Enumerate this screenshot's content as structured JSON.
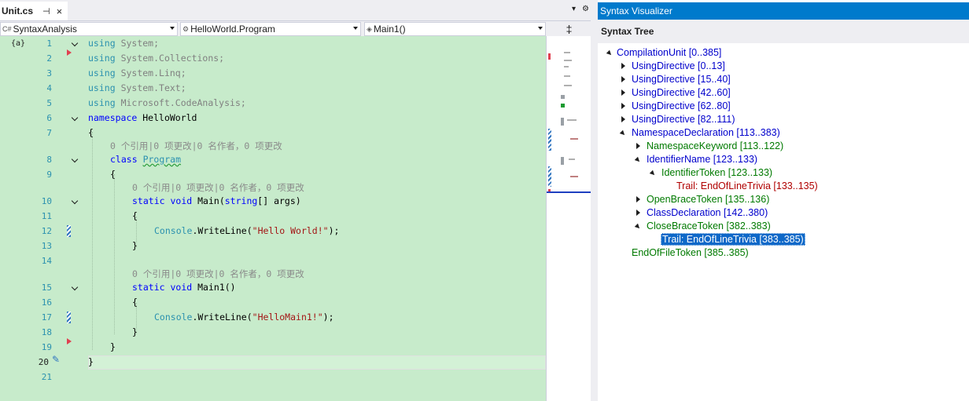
{
  "editor_tab": {
    "filename": "Unit.cs",
    "pin_glyph": "⊣",
    "close_glyph": "×"
  },
  "tabbar_controls": {
    "dropdown_glyph": "▾",
    "settings_glyph": "⚙"
  },
  "nav": {
    "project": "SyntaxAnalysis",
    "project_icon": "C#",
    "type": "HelloWorld.Program",
    "member": "Main1()",
    "split_glyph": "‡"
  },
  "code": {
    "line_numbers": [
      "1",
      "2",
      "3",
      "4",
      "5",
      "6",
      "7",
      "8",
      "9",
      "10",
      "11",
      "12",
      "13",
      "14",
      "15",
      "16",
      "17",
      "18",
      "19",
      "20",
      "21"
    ],
    "lens_text": "0 个引用|0 项更改|0 名作者，0 项更改",
    "using": "using",
    "usings": [
      "System;",
      "System.Collections;",
      "System.Linq;",
      "System.Text;",
      "Microsoft.CodeAnalysis;"
    ],
    "namespace_kw": "namespace",
    "namespace_name": "HelloWorld",
    "open_brace": "{",
    "close_brace": "}",
    "class_kw": "class",
    "class_name": "Program",
    "static_kw": "static",
    "void_kw": "void",
    "main_name": "Main(",
    "string_kw": "string",
    "args": "[] args)",
    "main1_name": "Main1()",
    "console": "Console",
    "writeline": ".WriteLine(",
    "hello_str": "\"Hello World!\"",
    "hellomain1_str": "\"HelloMain1!\"",
    "stmt_end": ");",
    "line1_icon": "{a}"
  },
  "syntax_visualizer": {
    "title": "Syntax Visualizer",
    "header": "Syntax Tree",
    "nodes": [
      {
        "label": "CompilationUnit [0..385]",
        "color": "blue"
      },
      {
        "label": "UsingDirective [0..13]",
        "color": "blue"
      },
      {
        "label": "UsingDirective [15..40]",
        "color": "blue"
      },
      {
        "label": "UsingDirective [42..60]",
        "color": "blue"
      },
      {
        "label": "UsingDirective [62..80]",
        "color": "blue"
      },
      {
        "label": "UsingDirective [82..111)",
        "color": "blue"
      },
      {
        "label": "NamespaceDeclaration [113..383)",
        "color": "blue"
      },
      {
        "label": "NamespaceKeyword [113..122)",
        "color": "green"
      },
      {
        "label": "IdentifierName [123..133)",
        "color": "blue"
      },
      {
        "label": "IdentifierToken [123..133)",
        "color": "green"
      },
      {
        "label": "Trail: EndOfLineTrivia [133..135)",
        "color": "red"
      },
      {
        "label": "OpenBraceToken [135..136)",
        "color": "green"
      },
      {
        "label": "ClassDeclaration [142..380)",
        "color": "blue"
      },
      {
        "label": "CloseBraceToken [382..383)",
        "color": "green"
      },
      {
        "label": "Trail: EndOfLineTrivia [383..385)",
        "color": "selected"
      },
      {
        "label": "EndOfFileToken [385..385)",
        "color": "green"
      }
    ]
  },
  "colors": {
    "accent": "#007acc",
    "editor_bg": "#c7ebcb",
    "keyword": "#0000ff",
    "type": "#2b91af",
    "string": "#a31515"
  }
}
